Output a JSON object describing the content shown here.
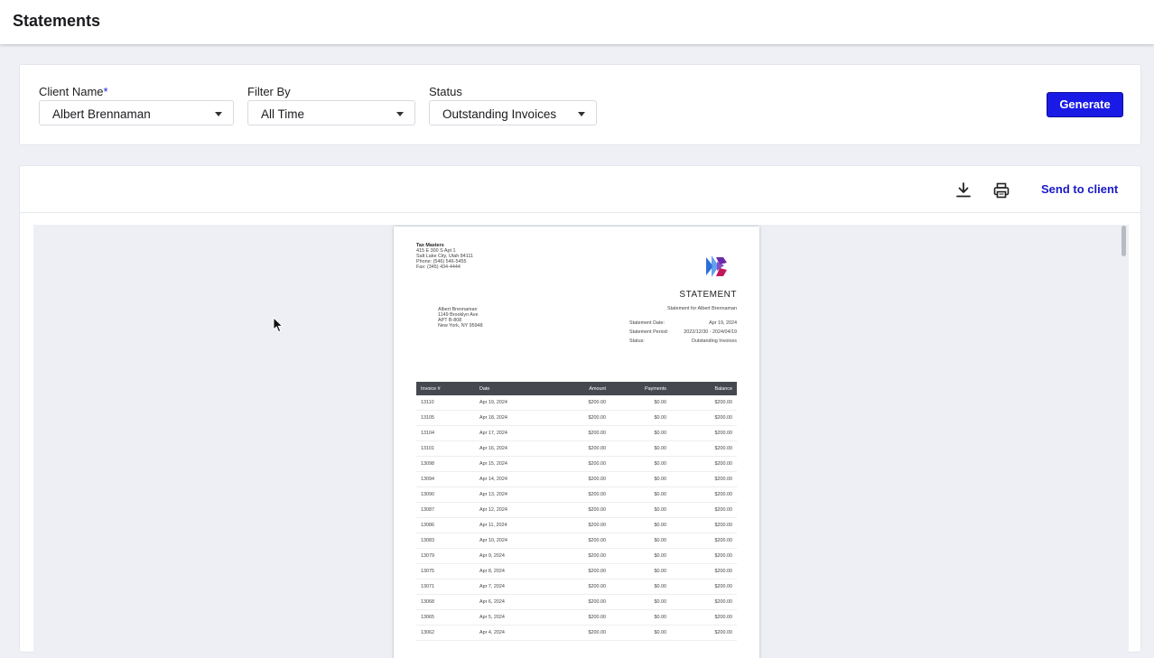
{
  "header": {
    "title": "Statements"
  },
  "filters": {
    "client": {
      "label": "Client Name",
      "required_mark": "*",
      "value": "Albert Brennaman"
    },
    "filter_by": {
      "label": "Filter By",
      "value": "All Time"
    },
    "status": {
      "label": "Status",
      "value": "Outstanding Invoices"
    },
    "generate_label": "Generate"
  },
  "toolbar": {
    "download_icon": "download-icon",
    "print_icon": "printer-icon",
    "send_label": "Send to client"
  },
  "colors": {
    "accent": "#1a1ae6",
    "table_header": "#45484f",
    "logo_blue": "#2b6fd6",
    "logo_magenta": "#c2185b"
  },
  "statement": {
    "company": {
      "name": "Tax Masters",
      "lines": [
        "415 E 300 S Apt 1",
        "Salt Lake City, Utah 84111",
        "Phone: (546) 546-5455",
        "Fax: (345) 434-4444"
      ]
    },
    "title": "STATEMENT",
    "subtitle": "Statement for Albert Brennaman",
    "recipient": {
      "lines": [
        "Albert Brennaman",
        "1149 Brooklyn Ave",
        "APT B-808",
        "New York, NY 95948"
      ]
    },
    "meta": [
      {
        "label": "Statement Date:",
        "value": "Apr 19, 2024"
      },
      {
        "label": "Statement Period:",
        "value": "2022/12/30 - 2024/04/19"
      },
      {
        "label": "Status:",
        "value": "Outstanding Invoices"
      }
    ],
    "columns": [
      "Invoice #",
      "Date",
      "Amount",
      "Payments",
      "Balance"
    ],
    "rows": [
      [
        "13110",
        "Apr 19, 2024",
        "$200.00",
        "$0.00",
        "$200.00"
      ],
      [
        "13105",
        "Apr 18, 2024",
        "$200.00",
        "$0.00",
        "$200.00"
      ],
      [
        "13104",
        "Apr 17, 2024",
        "$200.00",
        "$0.00",
        "$200.00"
      ],
      [
        "13101",
        "Apr 16, 2024",
        "$200.00",
        "$0.00",
        "$200.00"
      ],
      [
        "13098",
        "Apr 15, 2024",
        "$200.00",
        "$0.00",
        "$200.00"
      ],
      [
        "13094",
        "Apr 14, 2024",
        "$200.00",
        "$0.00",
        "$200.00"
      ],
      [
        "13090",
        "Apr 13, 2024",
        "$200.00",
        "$0.00",
        "$200.00"
      ],
      [
        "13087",
        "Apr 12, 2024",
        "$200.00",
        "$0.00",
        "$200.00"
      ],
      [
        "13086",
        "Apr 11, 2024",
        "$200.00",
        "$0.00",
        "$200.00"
      ],
      [
        "13083",
        "Apr 10, 2024",
        "$200.00",
        "$0.00",
        "$200.00"
      ],
      [
        "13079",
        "Apr 9, 2024",
        "$200.00",
        "$0.00",
        "$200.00"
      ],
      [
        "13075",
        "Apr 8, 2024",
        "$200.00",
        "$0.00",
        "$200.00"
      ],
      [
        "13071",
        "Apr 7, 2024",
        "$200.00",
        "$0.00",
        "$200.00"
      ],
      [
        "13068",
        "Apr 6, 2024",
        "$200.00",
        "$0.00",
        "$200.00"
      ],
      [
        "13065",
        "Apr 5, 2024",
        "$200.00",
        "$0.00",
        "$200.00"
      ],
      [
        "13062",
        "Apr 4, 2024",
        "$200.00",
        "$0.00",
        "$200.00"
      ]
    ]
  }
}
